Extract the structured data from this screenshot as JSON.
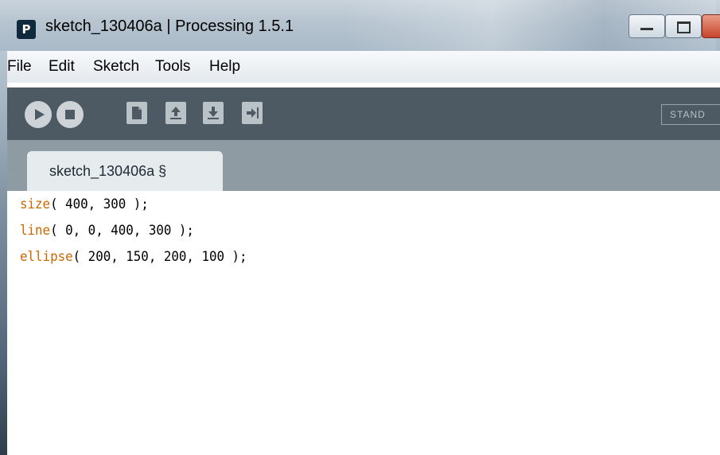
{
  "window": {
    "app_icon_letter": "P",
    "title": "sketch_130406a | Processing 1.5.1"
  },
  "menu": [
    "File",
    "Edit",
    "Sketch",
    "Tools",
    "Help"
  ],
  "toolbar": {
    "buttons": [
      "run",
      "stop",
      "new",
      "open",
      "save",
      "export"
    ],
    "mode_label": "STAND"
  },
  "tab": {
    "label": "sketch_130406a §"
  },
  "code": [
    {
      "fn": "size",
      "rest": "( 400, 300 );"
    },
    {
      "fn": "line",
      "rest": "( 0, 0, 400, 300 );"
    },
    {
      "fn": "ellipse",
      "rest": "( 200, 150, 200, 100 );"
    }
  ],
  "colors": {
    "keyword": "#cc6600",
    "toolbar_bg": "#4d5a63",
    "tab_row_bg": "#8e9ba3"
  }
}
